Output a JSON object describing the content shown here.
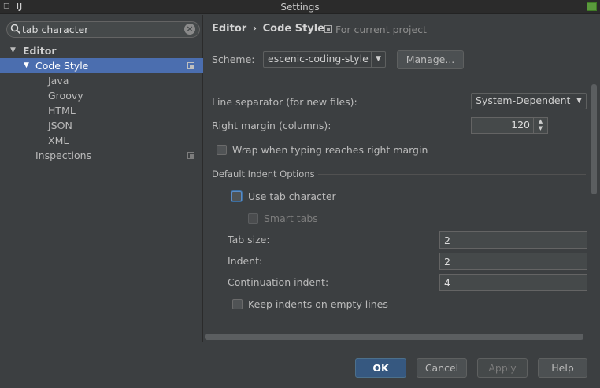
{
  "window": {
    "title": "Settings",
    "app_icon": "intellij-icon",
    "menu_icon": "window-menu-icon"
  },
  "search": {
    "value": "tab character"
  },
  "tree": {
    "editor": "Editor",
    "code_style": "Code Style",
    "children": [
      "Java",
      "Groovy",
      "HTML",
      "JSON",
      "XML"
    ],
    "inspections": "Inspections"
  },
  "header": {
    "crumb_root": "Editor",
    "crumb_sep": "›",
    "crumb_leaf": "Code Style",
    "project_label": "For current project"
  },
  "scheme": {
    "label": "Scheme:",
    "value": "escenic-coding-style",
    "manage": "Manage..."
  },
  "line_separator": {
    "label": "Line separator (for new files):",
    "value": "System-Dependent"
  },
  "right_margin": {
    "label": "Right margin (columns):",
    "value": "120"
  },
  "wrap": {
    "label": "Wrap when typing reaches right margin",
    "checked": false
  },
  "indent": {
    "section": "Default Indent Options",
    "use_tab": "Use tab character",
    "smart_tabs": "Smart tabs",
    "tab_size_label": "Tab size:",
    "tab_size": "2",
    "indent_label": "Indent:",
    "indent": "2",
    "continuation_label": "Continuation indent:",
    "continuation": "4",
    "keep_empty": "Keep indents on empty lines"
  },
  "footer": {
    "ok": "OK",
    "cancel": "Cancel",
    "apply": "Apply",
    "help": "Help"
  },
  "colors": {
    "selection": "#4b6eaf",
    "background": "#3c3f41",
    "primary_button": "#365880"
  }
}
